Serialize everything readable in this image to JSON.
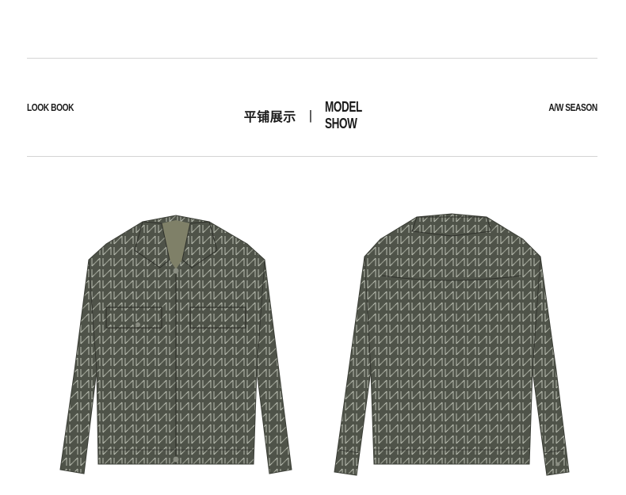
{
  "header": {
    "left_label": "LOOK BOOK",
    "center_title_cn": "平铺展示",
    "separator": "|",
    "center_title_en": "MODEL SHOW",
    "right_label": "A/W SEASON"
  },
  "products": [
    {
      "view": "front",
      "icon": "jacket-front-icon"
    },
    {
      "view": "back",
      "icon": "jacket-back-icon"
    }
  ],
  "colors": {
    "jacket_base": "#4f5349",
    "jacket_pattern": "#b9bdb1",
    "rule": "#d4d4d4"
  }
}
